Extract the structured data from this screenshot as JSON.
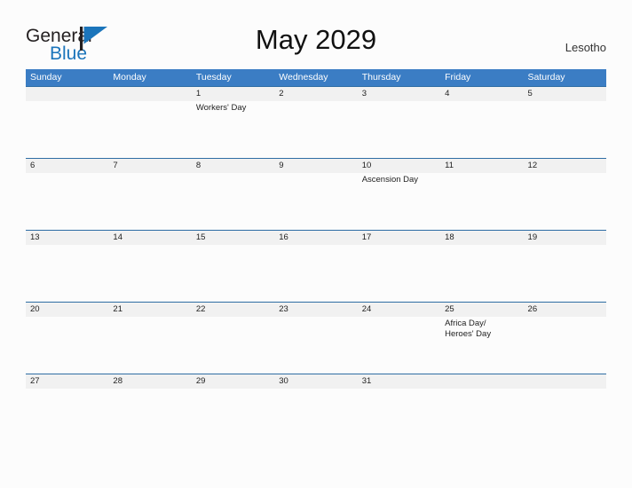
{
  "brand": {
    "name_part1": "General",
    "name_part2": "Blue",
    "flag_icon": "flag-triangle-icon",
    "accent_color": "#1b75bb"
  },
  "header": {
    "title": "May 2029",
    "country": "Lesotho"
  },
  "colors": {
    "weekday_header_bg": "#3b7dc4",
    "week_separator": "#2e6da4",
    "date_band_bg": "#f1f1f1",
    "page_bg": "#fcfcfc",
    "text": "#222222"
  },
  "calendar": {
    "month": "May",
    "year": "2029",
    "weekday_labels": [
      "Sunday",
      "Monday",
      "Tuesday",
      "Wednesday",
      "Thursday",
      "Friday",
      "Saturday"
    ],
    "weeks": [
      [
        {
          "date": "",
          "event": ""
        },
        {
          "date": "",
          "event": ""
        },
        {
          "date": "1",
          "event": "Workers' Day"
        },
        {
          "date": "2",
          "event": ""
        },
        {
          "date": "3",
          "event": ""
        },
        {
          "date": "4",
          "event": ""
        },
        {
          "date": "5",
          "event": ""
        }
      ],
      [
        {
          "date": "6",
          "event": ""
        },
        {
          "date": "7",
          "event": ""
        },
        {
          "date": "8",
          "event": ""
        },
        {
          "date": "9",
          "event": ""
        },
        {
          "date": "10",
          "event": "Ascension Day"
        },
        {
          "date": "11",
          "event": ""
        },
        {
          "date": "12",
          "event": ""
        }
      ],
      [
        {
          "date": "13",
          "event": ""
        },
        {
          "date": "14",
          "event": ""
        },
        {
          "date": "15",
          "event": ""
        },
        {
          "date": "16",
          "event": ""
        },
        {
          "date": "17",
          "event": ""
        },
        {
          "date": "18",
          "event": ""
        },
        {
          "date": "19",
          "event": ""
        }
      ],
      [
        {
          "date": "20",
          "event": ""
        },
        {
          "date": "21",
          "event": ""
        },
        {
          "date": "22",
          "event": ""
        },
        {
          "date": "23",
          "event": ""
        },
        {
          "date": "24",
          "event": ""
        },
        {
          "date": "25",
          "event": "Africa Day/ Heroes' Day"
        },
        {
          "date": "26",
          "event": ""
        }
      ],
      [
        {
          "date": "27",
          "event": ""
        },
        {
          "date": "28",
          "event": ""
        },
        {
          "date": "29",
          "event": ""
        },
        {
          "date": "30",
          "event": ""
        },
        {
          "date": "31",
          "event": ""
        },
        {
          "date": "",
          "event": ""
        },
        {
          "date": "",
          "event": ""
        }
      ]
    ]
  }
}
